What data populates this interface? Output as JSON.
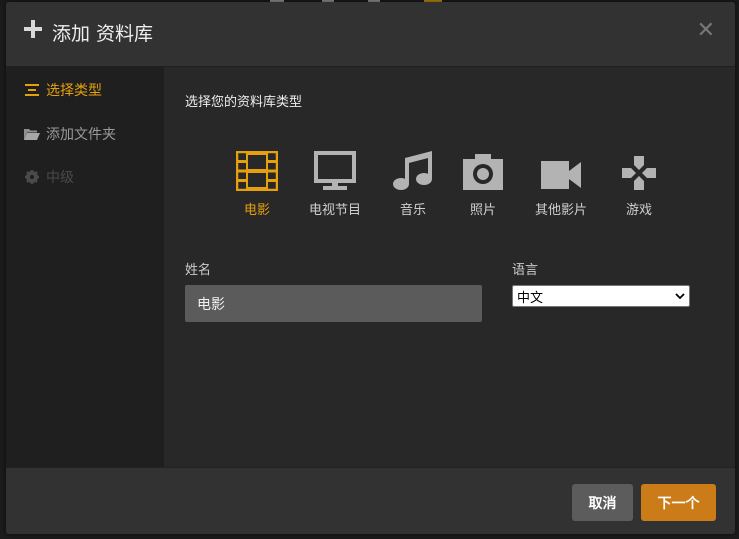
{
  "header": {
    "title": "添加 资料库"
  },
  "sidebar": {
    "items": [
      {
        "label": "选择类型",
        "icon": "list-icon",
        "state": "active"
      },
      {
        "label": "添加文件夹",
        "icon": "folder-open-icon",
        "state": "normal"
      },
      {
        "label": "中级",
        "icon": "gear-icon",
        "state": "disabled"
      }
    ]
  },
  "main": {
    "subtitle": "选择您的资料库类型",
    "types": [
      {
        "label": "电影",
        "icon": "film-icon",
        "active": true
      },
      {
        "label": "电视节目",
        "icon": "tv-icon",
        "active": false
      },
      {
        "label": "音乐",
        "icon": "music-note-icon",
        "active": false
      },
      {
        "label": "照片",
        "icon": "camera-icon",
        "active": false
      },
      {
        "label": "其他影片",
        "icon": "video-camera-icon",
        "active": false
      },
      {
        "label": "游戏",
        "icon": "gamepad-icon",
        "active": false
      }
    ],
    "name_label": "姓名",
    "name_value": "电影",
    "language_label": "语言",
    "language_value": "中文"
  },
  "footer": {
    "cancel_label": "取消",
    "next_label": "下一个"
  },
  "colors": {
    "accent": "#e5a00d",
    "icon": "#b3b3b3",
    "next_button": "#cc7b19",
    "cancel_button": "#5c5c5c"
  }
}
